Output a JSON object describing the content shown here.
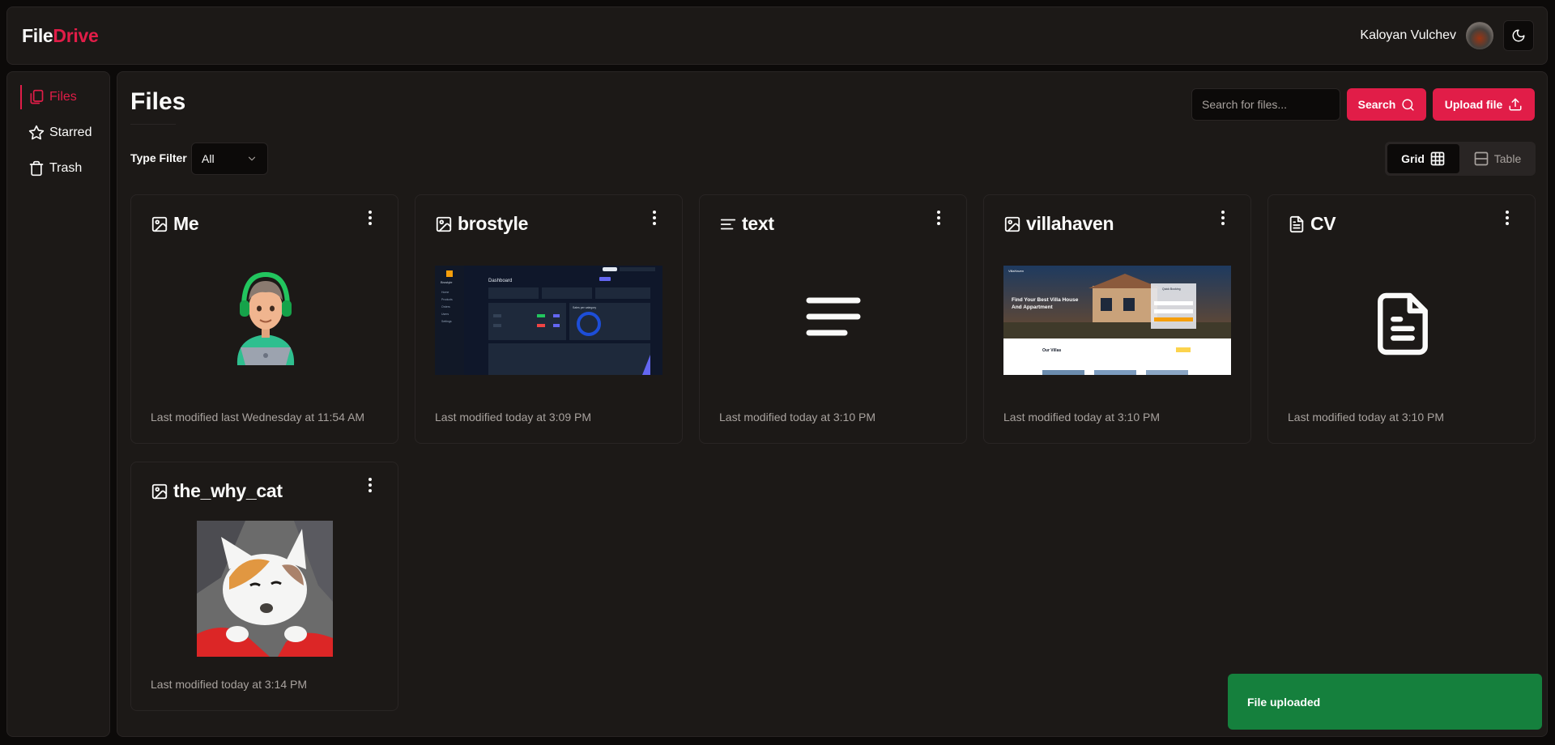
{
  "header": {
    "logo_main": "File",
    "logo_accent": "Drive",
    "user_name": "Kaloyan Vulchev"
  },
  "sidebar": {
    "items": [
      {
        "label": "Files",
        "icon": "files-icon",
        "active": true
      },
      {
        "label": "Starred",
        "icon": "star-icon",
        "active": false
      },
      {
        "label": "Trash",
        "icon": "trash-icon",
        "active": false
      }
    ]
  },
  "main": {
    "title": "Files",
    "search_placeholder": "Search for files...",
    "search_label": "Search",
    "upload_label": "Upload file",
    "filter_label": "Type Filter",
    "filter_value": "All",
    "view_grid_label": "Grid",
    "view_table_label": "Table"
  },
  "files": [
    {
      "name": "Me",
      "type": "image",
      "modified": "Last modified last Wednesday at 11:54 AM"
    },
    {
      "name": "brostyle",
      "type": "image",
      "modified": "Last modified today at 3:09 PM"
    },
    {
      "name": "text",
      "type": "text",
      "modified": "Last modified today at 3:10 PM"
    },
    {
      "name": "villahaven",
      "type": "image",
      "modified": "Last modified today at 3:10 PM"
    },
    {
      "name": "CV",
      "type": "pdf",
      "modified": "Last modified today at 3:10 PM"
    },
    {
      "name": "the_why_cat",
      "type": "image",
      "modified": "Last modified today at 3:14 PM"
    }
  ],
  "thumbnails": {
    "brostyle": {
      "title": "Dashboard",
      "brand": "Brostyle",
      "nav": [
        "Home",
        "Products",
        "Orders",
        "Users",
        "Settings"
      ],
      "chart_title": "Sales per category"
    },
    "villahaven": {
      "brand": "VillaHaven",
      "headline_1": "Find Your Best Villa House",
      "headline_2": "And Appartment",
      "section": "Our Villas",
      "form_title": "Quick Booking"
    }
  },
  "toast": {
    "message": "File uploaded"
  },
  "colors": {
    "accent": "#e11d48",
    "success": "#15803d",
    "background": "#0c0a09",
    "card": "#1c1917"
  }
}
